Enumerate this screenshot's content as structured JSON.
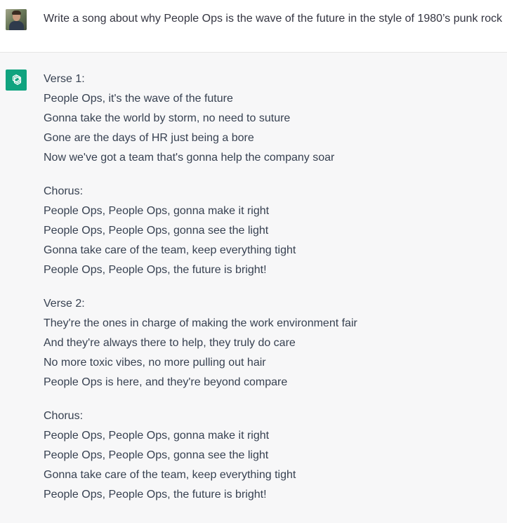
{
  "user_message": {
    "text": "Write a song about why People Ops is the wave of the future in the style of 1980’s punk rock"
  },
  "assistant_message": {
    "stanzas": [
      {
        "lines": [
          "Verse 1:",
          "People Ops, it's the wave of the future",
          "Gonna take the world by storm, no need to suture",
          "Gone are the days of HR just being a bore",
          "Now we've got a team that's gonna help the company soar"
        ]
      },
      {
        "lines": [
          "Chorus:",
          "People Ops, People Ops, gonna make it right",
          "People Ops, People Ops, gonna see the light",
          "Gonna take care of the team, keep everything tight",
          "People Ops, People Ops, the future is bright!"
        ]
      },
      {
        "lines": [
          "Verse 2:",
          "They're the ones in charge of making the work environment fair",
          "And they're always there to help, they truly do care",
          "No more toxic vibes, no more pulling out hair",
          "People Ops is here, and they're beyond compare"
        ]
      },
      {
        "lines": [
          "Chorus:",
          "People Ops, People Ops, gonna make it right",
          "People Ops, People Ops, gonna see the light",
          "Gonna take care of the team, keep everything tight",
          "People Ops, People Ops, the future is bright!"
        ]
      }
    ]
  },
  "colors": {
    "assistant_avatar_bg": "#10a37f",
    "assistant_row_bg": "#f7f7f8",
    "user_row_bg": "#ffffff",
    "text": "#374151"
  },
  "icons": {
    "user_avatar": "user-photo-avatar",
    "assistant_avatar": "openai-logo-icon"
  }
}
